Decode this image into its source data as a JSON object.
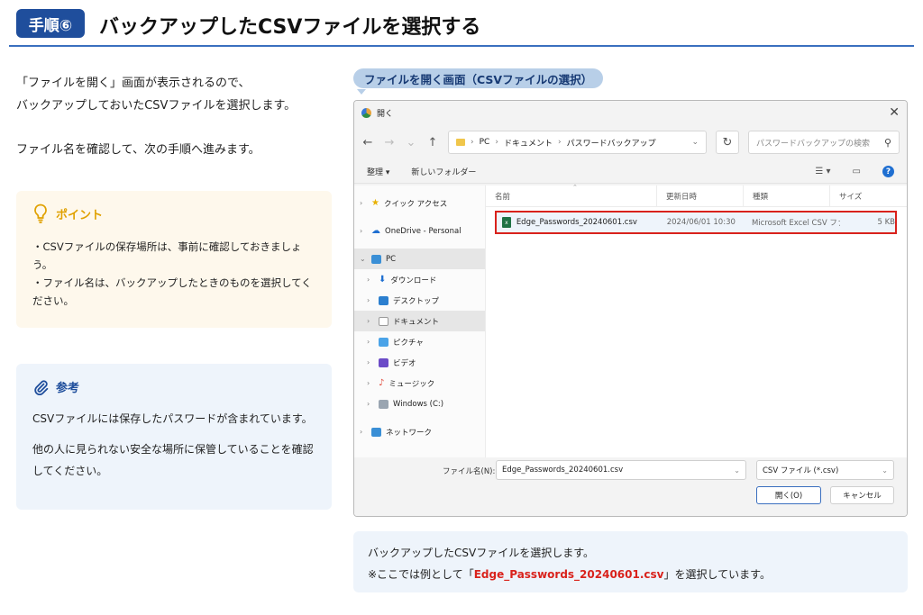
{
  "header": {
    "step_badge": "手順⑥",
    "title": "バックアップしたCSVファイルを選択する"
  },
  "intro": {
    "line1": "「ファイルを開く」画面が表示されるので、",
    "line2": "バックアップしておいたCSVファイルを選択します。",
    "line3": "ファイル名を確認して、次の手順へ進みます。"
  },
  "point": {
    "heading": "ポイント",
    "items": [
      "・CSVファイルの保存場所は、事前に確認しておきましょう。",
      "・ファイル名は、バックアップしたときのものを選択してください。"
    ]
  },
  "reference": {
    "heading": "参考",
    "para1": "CSVファイルには保存したパスワードが含まれています。",
    "para2": "他の人に見られない安全な場所に保管していることを確認してください。"
  },
  "caption": "ファイルを開く画面（CSVファイルの選択）",
  "dialog": {
    "title": "開く",
    "breadcrumb": [
      "PC",
      "ドキュメント",
      "パスワードバックアップ"
    ],
    "search_placeholder": "パスワードバックアップの検索",
    "cmd_organize": "整理 ▾",
    "cmd_new_folder": "新しいフォルダー",
    "columns": {
      "name": "名前",
      "date": "更新日時",
      "type": "種類",
      "size": "サイズ"
    },
    "nav": {
      "quick_access": "クイック アクセス",
      "onedrive": "OneDrive - Personal",
      "pc": "PC",
      "downloads": "ダウンロード",
      "desktop": "デスクトップ",
      "documents": "ドキュメント",
      "pictures": "ピクチャ",
      "videos": "ビデオ",
      "music": "ミュージック",
      "windows_c": "Windows (C:)",
      "network": "ネットワーク"
    },
    "file": {
      "name": "Edge_Passwords_20240601.csv",
      "date": "2024/06/01 10:30",
      "type": "Microsoft Excel CSV ファイル",
      "size": "5 KB"
    },
    "filename_label": "ファイル名(N):",
    "filename_value": "Edge_Passwords_20240601.csv",
    "filetype_value": "CSV ファイル (*.csv)",
    "open_button": "開く(O)",
    "cancel_button": "キャンセル"
  },
  "note": {
    "line1": "バックアップしたCSVファイルを選択します。",
    "line2_prefix": "※ここでは例として「",
    "line2_highlight": "Edge_Passwords_20240601.csv",
    "line2_suffix": "」を選択しています。"
  },
  "colors": {
    "brand_blue": "#1f4e9c",
    "highlight_red": "#d9221c",
    "point_yellow": "#e0a100"
  }
}
